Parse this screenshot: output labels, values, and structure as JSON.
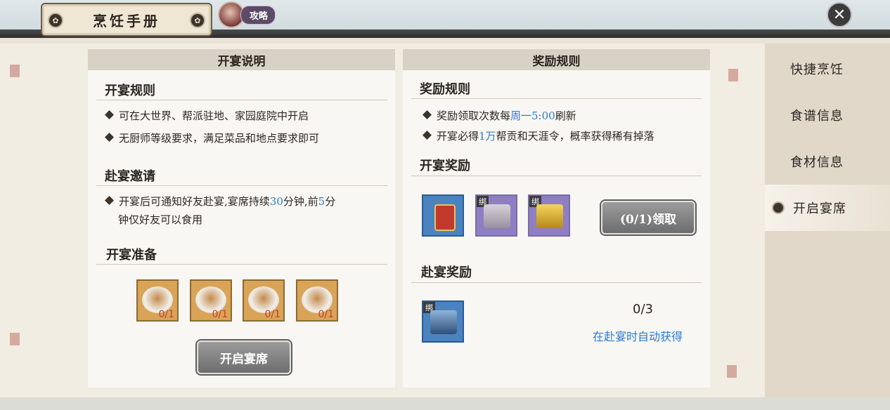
{
  "header": {
    "title": "烹饪手册",
    "guide_label": "攻略"
  },
  "sidebar": {
    "items": [
      {
        "label": "快捷烹饪",
        "active": false
      },
      {
        "label": "食谱信息",
        "active": false
      },
      {
        "label": "食材信息",
        "active": false
      },
      {
        "label": "开启宴席",
        "active": true
      }
    ]
  },
  "left_panel": {
    "header": "开宴说明",
    "rules": {
      "title": "开宴规则",
      "bullets": [
        "可在大世界、帮派驻地、家园庭院中开启",
        "无厨师等级要求，满足菜品和地点要求即可"
      ]
    },
    "invite": {
      "title": "赴宴邀请",
      "line1_a": "开宴后可通知好友赴宴,宴席持续",
      "line1_num1": "30",
      "line1_b": "分钟,前",
      "line1_num2": "5",
      "line1_c": "分",
      "line2": "钟仅好友可以食用"
    },
    "prep": {
      "title": "开宴准备",
      "dishes": [
        {
          "icon": "dish-icon",
          "count": "0/1"
        },
        {
          "icon": "dish-icon",
          "count": "0/1"
        },
        {
          "icon": "dish-icon",
          "count": "0/1"
        },
        {
          "icon": "dish-icon",
          "count": "0/1"
        }
      ]
    },
    "start_button": "开启宴席"
  },
  "right_panel": {
    "header": "奖励规则",
    "rules": {
      "title": "奖励规则",
      "b1_a": "奖励领取次数每",
      "b1_hl": "周一5:00",
      "b1_b": "刷新",
      "b2_a": "开宴必得",
      "b2_hl": "1万",
      "b2_b": "帮贡和天涯令，概率获得稀有掉落"
    },
    "host_rewards": {
      "title": "开宴奖励",
      "bind_label": "绑",
      "claim_button": "(0/1)领取"
    },
    "guest_rewards": {
      "title": "赴宴奖励",
      "bind_label": "绑",
      "count": "0/3",
      "auto_text": "在赴宴时自动获得"
    }
  },
  "colors": {
    "highlight": "#2b7bd0",
    "count_red": "#c24131"
  }
}
